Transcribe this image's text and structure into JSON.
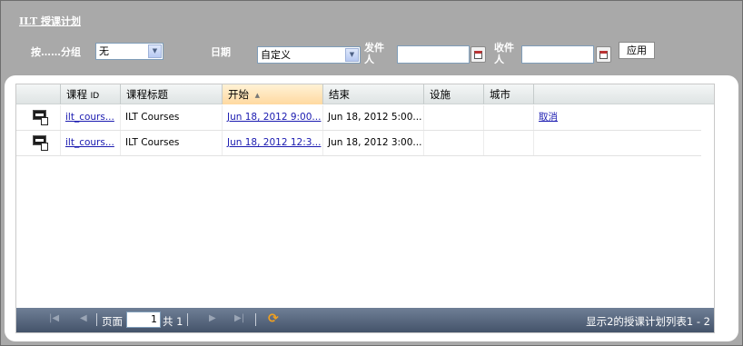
{
  "title": "ILT 授课计划",
  "filters": {
    "group_label": "按……分组",
    "group_value": "无",
    "date_label": "日期",
    "date_value": "自定义",
    "from_label": "发件人",
    "to_label": "收件人",
    "from_value": "",
    "to_value": "",
    "apply_label": "应用"
  },
  "grid": {
    "columns": {
      "course_id_main": "课程",
      "course_id_suffix": "ID",
      "course_title": "课程标题",
      "start": "开始",
      "end": "结束",
      "facility": "设施",
      "city": "城市"
    },
    "rows": [
      {
        "course_id": "ilt_cours...",
        "title": "ILT Courses",
        "start": "Jun 18, 2012 9:00...",
        "end": "Jun 18, 2012 5:00...",
        "facility": "",
        "city": "",
        "action": "取消"
      },
      {
        "course_id": "ilt_cours...",
        "title": "ILT Courses",
        "start": "Jun 18, 2012 12:3...",
        "end": "Jun 18, 2012 3:00...",
        "facility": "",
        "city": "",
        "action": ""
      }
    ]
  },
  "pager": {
    "page_label": "页面",
    "page_value": "1",
    "of_label": "共 1",
    "summary": "显示2的授课计划列表1 - 2"
  }
}
